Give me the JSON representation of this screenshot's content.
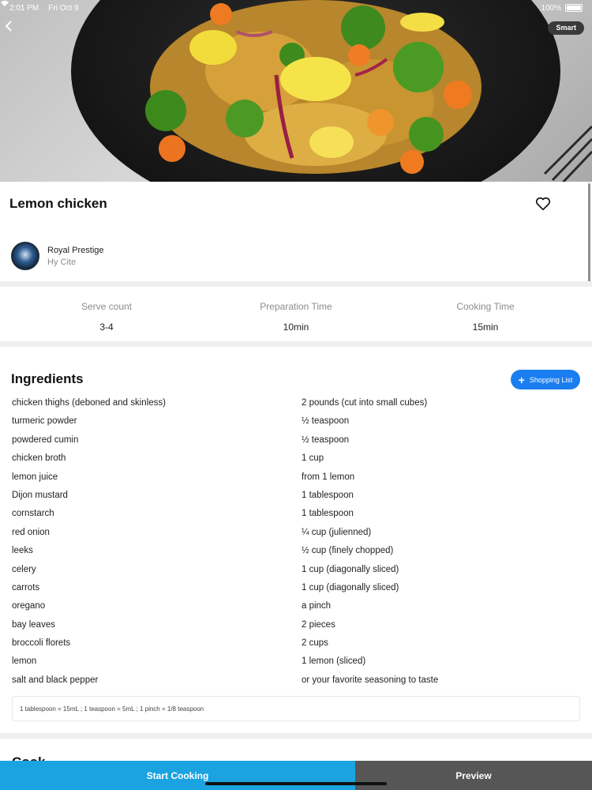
{
  "status": {
    "time": "2:01 PM",
    "date": "Fri Oct 9",
    "battery": "100%"
  },
  "header": {
    "badge": "Smart"
  },
  "recipe": {
    "title": "Lemon chicken"
  },
  "author": {
    "name": "Royal Prestige",
    "subtitle": "Hy Cite"
  },
  "stats": [
    {
      "label": "Serve count",
      "value": "3-4"
    },
    {
      "label": "Preparation Time",
      "value": "10min"
    },
    {
      "label": "Cooking Time",
      "value": "15min"
    }
  ],
  "ingredients": {
    "title": "Ingredients",
    "shopping_label": "Shopping List",
    "items": [
      {
        "name": "chicken thighs (deboned and skinless)",
        "qty": "2 pounds (cut into small cubes)"
      },
      {
        "name": "turmeric powder",
        "qty": "½ teaspoon"
      },
      {
        "name": "powdered cumin",
        "qty": "½ teaspoon"
      },
      {
        "name": "chicken broth",
        "qty": "1 cup"
      },
      {
        "name": "lemon juice",
        "qty": "from 1 lemon"
      },
      {
        "name": "Dijon mustard",
        "qty": "1 tablespoon"
      },
      {
        "name": "cornstarch",
        "qty": "1 tablespoon"
      },
      {
        "name": "red onion",
        "qty": "¼ cup (julienned)"
      },
      {
        "name": "leeks",
        "qty": "½ cup (finely chopped)"
      },
      {
        "name": "celery",
        "qty": "1 cup (diagonally sliced)"
      },
      {
        "name": "carrots",
        "qty": "1 cup (diagonally sliced)"
      },
      {
        "name": "oregano",
        "qty": "a pinch"
      },
      {
        "name": "bay leaves",
        "qty": "2 pieces"
      },
      {
        "name": "broccoli florets",
        "qty": "2 cups"
      },
      {
        "name": "lemon",
        "qty": "1 lemon (sliced)"
      },
      {
        "name": "salt and black pepper",
        "qty": "or your favorite seasoning to taste"
      }
    ],
    "note": "1 tablespoon = 15mL ; 1 teaspoon = 5mL ; 1 pinch = 1/8 teaspoon"
  },
  "cooking": {
    "title_partial": "Cook"
  },
  "actions": {
    "start": "Start Cooking",
    "preview": "Preview"
  }
}
